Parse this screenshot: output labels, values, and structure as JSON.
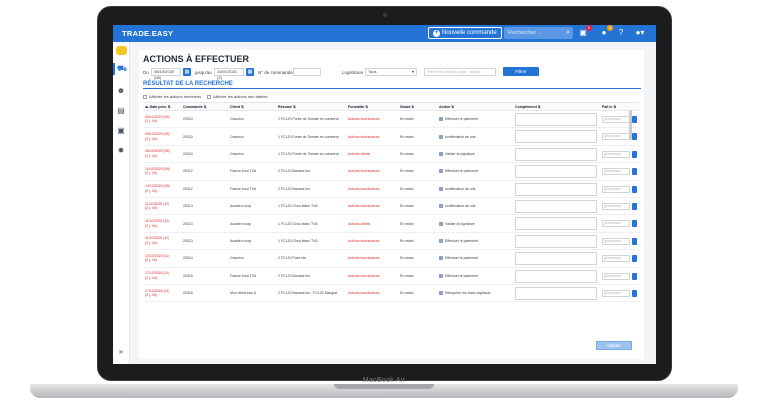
{
  "device": {
    "model_label": "MacBook Air"
  },
  "header": {
    "brand": "TRADE.EASY",
    "new_order_label": "Nouvelle commande",
    "search_placeholder": "Rechercher ...",
    "badges": {
      "cart": "3",
      "notifications": "1"
    },
    "colors": {
      "primary": "#2474d6",
      "danger": "#dc2626"
    }
  },
  "page": {
    "title": "ACTIONS À EFFECTUER",
    "filters": {
      "from_label": "Du",
      "from_value": "08/10/2020 (08)",
      "to_label": "jusqu'au",
      "to_value": "10/01/2021 (2)",
      "order_label": "N° de commande",
      "order_value": "",
      "logistician_label": "Logisticien",
      "logistician_value": "Tous",
      "extra_placeholder": "Filtrer les actions (type, statut)",
      "filter_button": "Filtrer"
    },
    "section_title": "RÉSULTAT DE LA RECHERCHE",
    "checkboxes": {
      "finished": "Afficher les actions terminées",
      "deleted": "Afficher les actions non datées"
    },
    "columns": {
      "date": "Date prév.",
      "order": "Commande",
      "client": "Client",
      "summary": "Résumé",
      "formality": "Formalité",
      "status": "Statut",
      "action": "Action",
      "complement": "Complément",
      "done_by": "Fait le"
    },
    "done_placeholder": "jj/mm/aaaa",
    "validate_button": "Valider"
  },
  "rows": [
    {
      "date": "05/10/2020 (04)",
      "delay": "(2 j. 4h)",
      "order": "20310",
      "client": "Casorico",
      "summary": "1 FCL20 Purée de Tomate en conserve",
      "formality": "Actions fournisseurs",
      "status": "En retard",
      "action": "Effectuer le paiement"
    },
    {
      "date": "05/10/2020 (04)",
      "delay": "(2 j. 4h)",
      "order": "20310",
      "client": "Casorico",
      "summary": "1 FCL20 Purée de Tomate en conserve",
      "formality": "Actions fournisseurs",
      "status": "En retard",
      "action": "confirmation de cde"
    },
    {
      "date": "08/10/2020 (08)",
      "delay": "(2 j. 4h)",
      "order": "20310",
      "client": "Casorico",
      "summary": "1 FCL20 Purée de Tomate en conserve",
      "formality": "Actions clients",
      "status": "En retard",
      "action": "Valider la signature"
    },
    {
      "date": "10/10/2020 (09)",
      "delay": "(2 j. 4h)",
      "order": "20312",
      "client": "France food TVA",
      "summary": "2 FCL20 Banane bio",
      "formality": "Actions fournisseurs",
      "status": "En retard",
      "action": "Effectuer le paiement"
    },
    {
      "date": "10/10/2020 (09)",
      "delay": "(2 j. 4h)",
      "order": "20312",
      "client": "France food TVA",
      "summary": "2 FCL20 Banane bio",
      "formality": "Actions fournisseurs",
      "status": "En retard",
      "action": "confirmation de cde"
    },
    {
      "date": "11/10/2020 (10)",
      "delay": "(2 j. 4h)",
      "order": "20313",
      "client": "Acadien coop",
      "summary": "1 FCL20 Chou blanc TVA",
      "formality": "Actions fournisseurs",
      "status": "En retard",
      "action": "confirmation de cde"
    },
    {
      "date": "11/10/2020 (10)",
      "delay": "(2 j. 4h)",
      "order": "20313",
      "client": "Acadien coop",
      "summary": "1 FCL20 Chou blanc TVA",
      "formality": "Actions clients",
      "status": "En retard",
      "action": "Valider la signature"
    },
    {
      "date": "11/10/2020 (10)",
      "delay": "(2 j. 4h)",
      "order": "20313",
      "client": "Acadien coop",
      "summary": "1 FCL20 Chou blanc TVA",
      "formality": "Actions fournisseurs",
      "status": "En retard",
      "action": "Effectuer le paiement"
    },
    {
      "date": "13/10/2020 (11)",
      "delay": "(2 j. 4h)",
      "order": "20314",
      "client": "Casorico",
      "summary": "2 FCL20 Poire bio",
      "formality": "Actions fournisseurs",
      "status": "En retard",
      "action": "Effectuer le paiement"
    },
    {
      "date": "17/10/2020 (11)",
      "delay": "(2 j. 4h)",
      "order": "20315",
      "client": "France food TVA",
      "summary": "2 FCL20 Banane bio",
      "formality": "Actions fournisseurs",
      "status": "En retard",
      "action": "Effectuer le paiement"
    },
    {
      "date": "17/10/2020 (11)",
      "delay": "(2 j. 4h)",
      "order": "20316",
      "client": "Mon client eau &",
      "summary": "2 FCL20 Banane bio - FCL20 Mangue",
      "formality": "Actions fournisseurs",
      "status": "En retard",
      "action": "Récupérer les docs originaux"
    }
  ]
}
